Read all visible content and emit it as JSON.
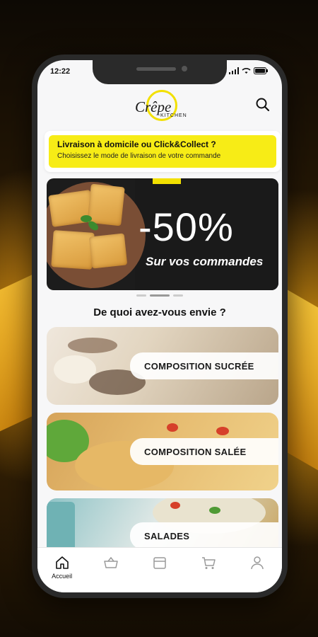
{
  "status_bar": {
    "time": "12:22"
  },
  "brand": {
    "name": "Crêpe",
    "sub": "KITCHEN"
  },
  "delivery": {
    "title": "Livraison à domicile ou Click&Collect ?",
    "subtitle": "Choisissez le mode de livraison de votre commande"
  },
  "banner": {
    "discount": "-50%",
    "tagline": "Sur vos commandes"
  },
  "section_title": "De quoi avez-vous envie ?",
  "categories": [
    {
      "label": "COMPOSITION SUCRÉE"
    },
    {
      "label": "COMPOSITION SALÉE"
    },
    {
      "label": "SALADES"
    }
  ],
  "tabbar": {
    "items": [
      {
        "label": "Accueil",
        "icon": "home-icon"
      },
      {
        "label": "",
        "icon": "basket-icon"
      },
      {
        "label": "",
        "icon": "store-icon"
      },
      {
        "label": "",
        "icon": "cart-icon"
      },
      {
        "label": "",
        "icon": "user-icon"
      }
    ]
  },
  "colors": {
    "accent": "#f7ec16",
    "banner_bg": "#1a1a1a"
  }
}
